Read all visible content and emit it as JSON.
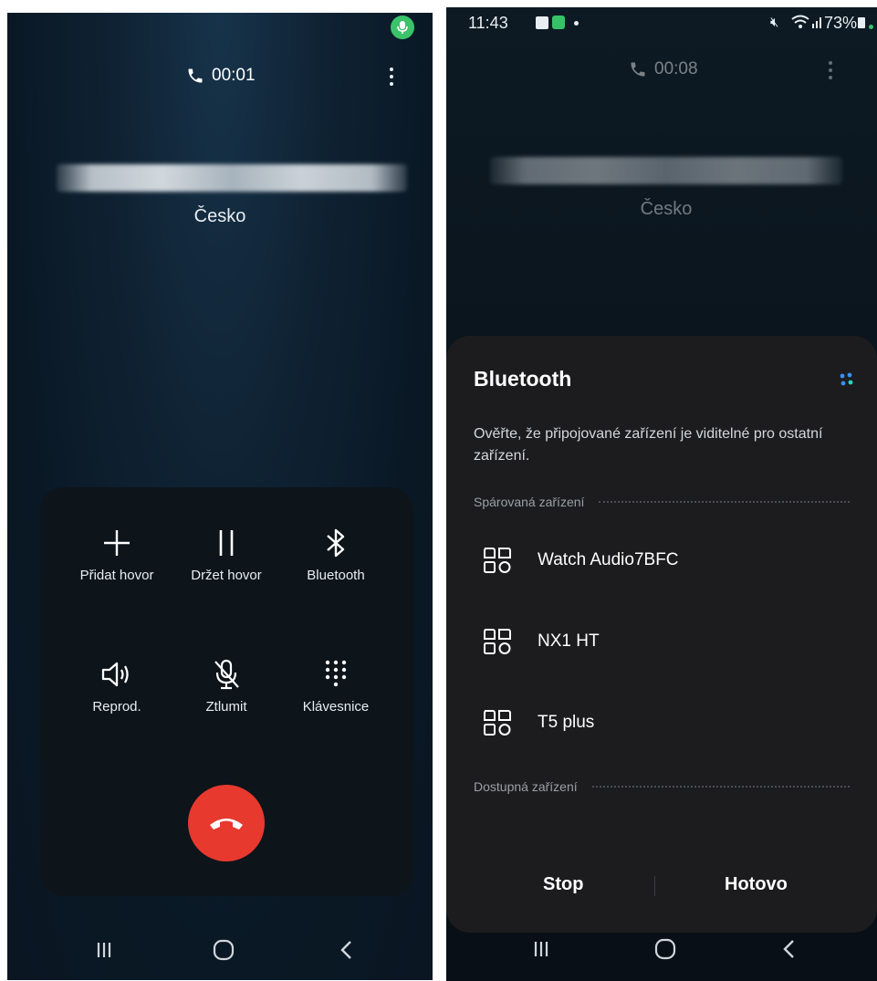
{
  "left": {
    "call_timer": "00:01",
    "country": "Česko",
    "controls": [
      {
        "label": "Přidat hovor",
        "icon": "plus-icon"
      },
      {
        "label": "Držet hovor",
        "icon": "pause-icon"
      },
      {
        "label": "Bluetooth",
        "icon": "bluetooth-icon"
      },
      {
        "label": "Reprod.",
        "icon": "speaker-icon"
      },
      {
        "label": "Ztlumit",
        "icon": "mic-off-icon"
      },
      {
        "label": "Klávesnice",
        "icon": "keypad-icon"
      }
    ],
    "end_call_icon": "end-call-icon",
    "mic_indicator_color": "#3ac36a",
    "end_call_color": "#e8392f"
  },
  "right": {
    "status": {
      "time": "11:43",
      "battery": "73%"
    },
    "call_timer": "00:08",
    "country": "Česko",
    "sheet": {
      "title": "Bluetooth",
      "description": "Ověřte, že připojované zařízení je viditelné pro ostatní zařízení.",
      "paired_label": "Spárovaná zařízení",
      "available_label": "Dostupná zařízení",
      "devices": [
        {
          "name": "Watch Audio7BFC",
          "icon": "device-generic-icon"
        },
        {
          "name": "NX1 HT",
          "icon": "device-generic-icon"
        },
        {
          "name": "T5 plus",
          "icon": "device-generic-icon"
        }
      ],
      "stop_label": "Stop",
      "done_label": "Hotovo",
      "accent_color": "#3b8ff3"
    }
  }
}
